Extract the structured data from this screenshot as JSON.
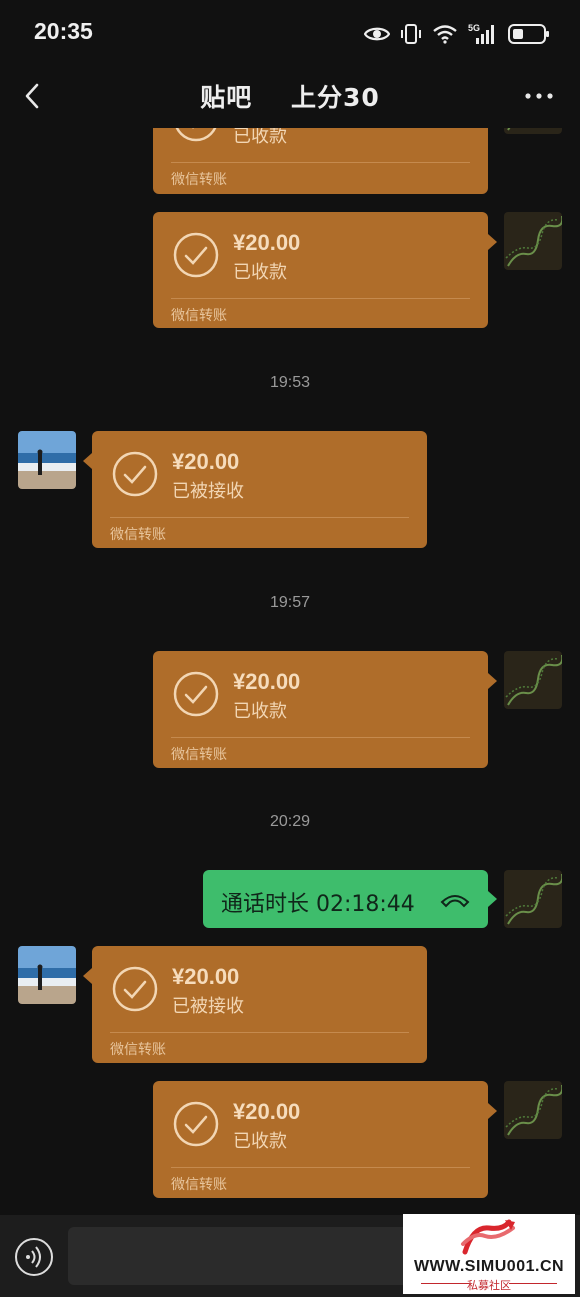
{
  "status_bar": {
    "time": "20:35"
  },
  "nav": {
    "title": "贴吧    上分30"
  },
  "messages": [
    {
      "type": "transfer",
      "side": "right",
      "amount": "",
      "status": "已收款",
      "footer": "微信转账"
    },
    {
      "type": "transfer",
      "side": "right",
      "amount": "¥20.00",
      "status": "已收款",
      "footer": "微信转账"
    },
    {
      "type": "time",
      "text": "19:53"
    },
    {
      "type": "transfer",
      "side": "left",
      "amount": "¥20.00",
      "status": "已被接收",
      "footer": "微信转账"
    },
    {
      "type": "time",
      "text": "19:57"
    },
    {
      "type": "transfer",
      "side": "right",
      "amount": "¥20.00",
      "status": "已收款",
      "footer": "微信转账"
    },
    {
      "type": "time",
      "text": "20:29"
    },
    {
      "type": "call",
      "side": "right",
      "text": "通话时长 02:18:44"
    },
    {
      "type": "transfer",
      "side": "left",
      "amount": "¥20.00",
      "status": "已被接收",
      "footer": "微信转账"
    },
    {
      "type": "transfer",
      "side": "right",
      "amount": "¥20.00",
      "status": "已收款",
      "footer": "微信转账"
    }
  ],
  "watermark": {
    "text": "WWW.SIMU001.CN",
    "sub": "私募社区"
  },
  "colors": {
    "transfer_bubble": "#af6d2a",
    "call_bubble": "#3ebd6c",
    "background": "#111111"
  }
}
